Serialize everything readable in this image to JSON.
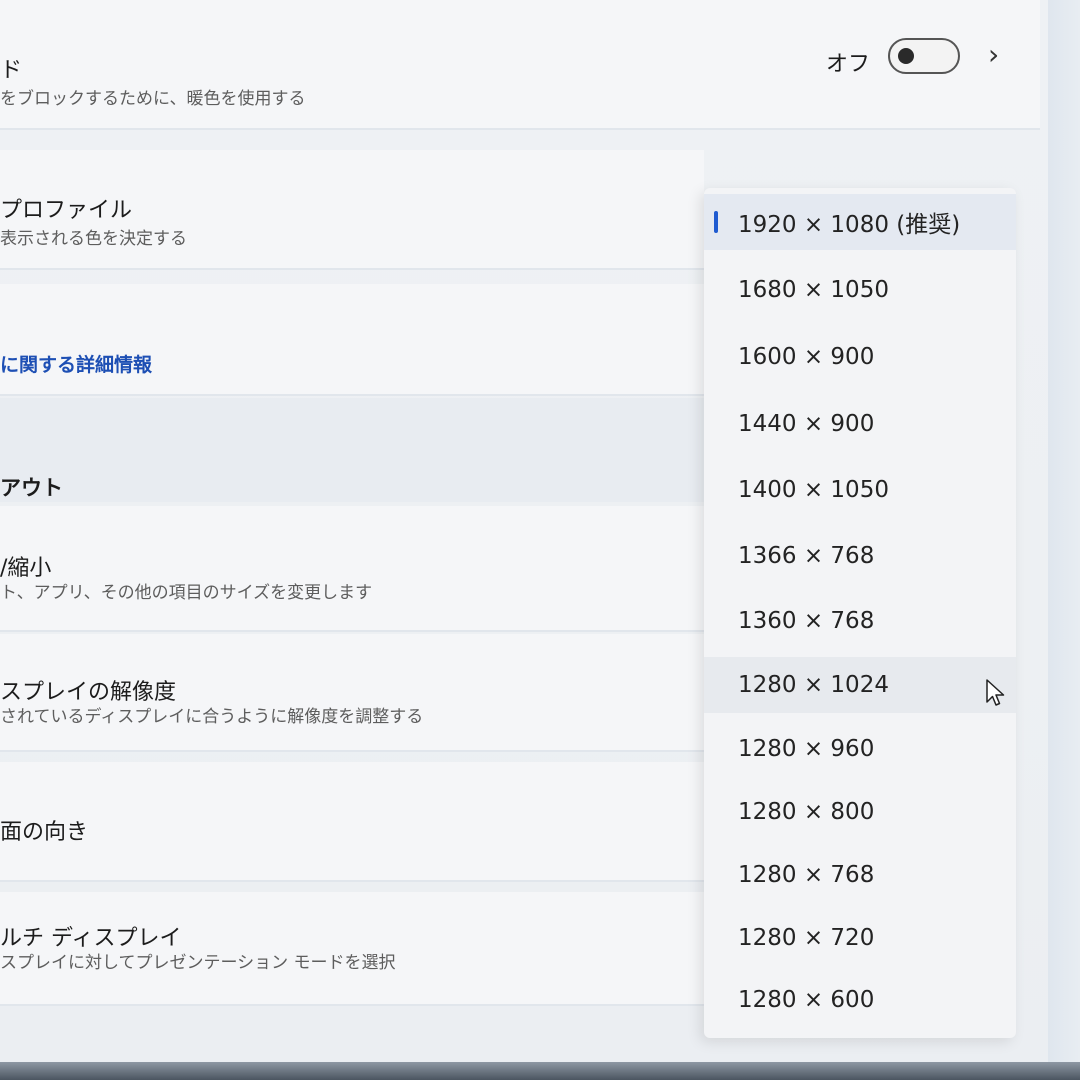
{
  "settings": {
    "night_light": {
      "title": "ド",
      "description": "をブロックするために、暖色を使用する",
      "toggle_state_label": "オフ",
      "toggle_on": false
    },
    "color_profile": {
      "title": "プロファイル",
      "description": "表示される色を決定する"
    },
    "hdr_link": "に関する詳細情報",
    "layout_section": "アウト",
    "scale": {
      "title": "/縮小",
      "description": "ト、アプリ、その他の項目のサイズを変更します"
    },
    "resolution": {
      "title": "スプレイの解像度",
      "description": "されているディスプレイに合うように解像度を調整する"
    },
    "orientation": {
      "title": "面の向き"
    },
    "multi_display": {
      "title": "ルチ ディスプレイ",
      "description": "スプレイに対してプレゼンテーション モードを選択"
    }
  },
  "resolution_dropdown": {
    "selected_index": 0,
    "hovered_index": 7,
    "options": [
      "1920 × 1080 (推奨)",
      "1680 × 1050",
      "1600 × 900",
      "1440 × 900",
      "1400 × 1050",
      "1366 × 768",
      "1360 × 768",
      "1280 × 1024",
      "1280 × 960",
      "1280 × 800",
      "1280 × 768",
      "1280 × 720",
      "1280 × 600"
    ]
  },
  "icons": {
    "chevron": "chevron-right-icon",
    "cursor": "mouse-pointer-icon"
  },
  "colors": {
    "accent": "#1f5bd0",
    "link": "#1d4fb4"
  }
}
